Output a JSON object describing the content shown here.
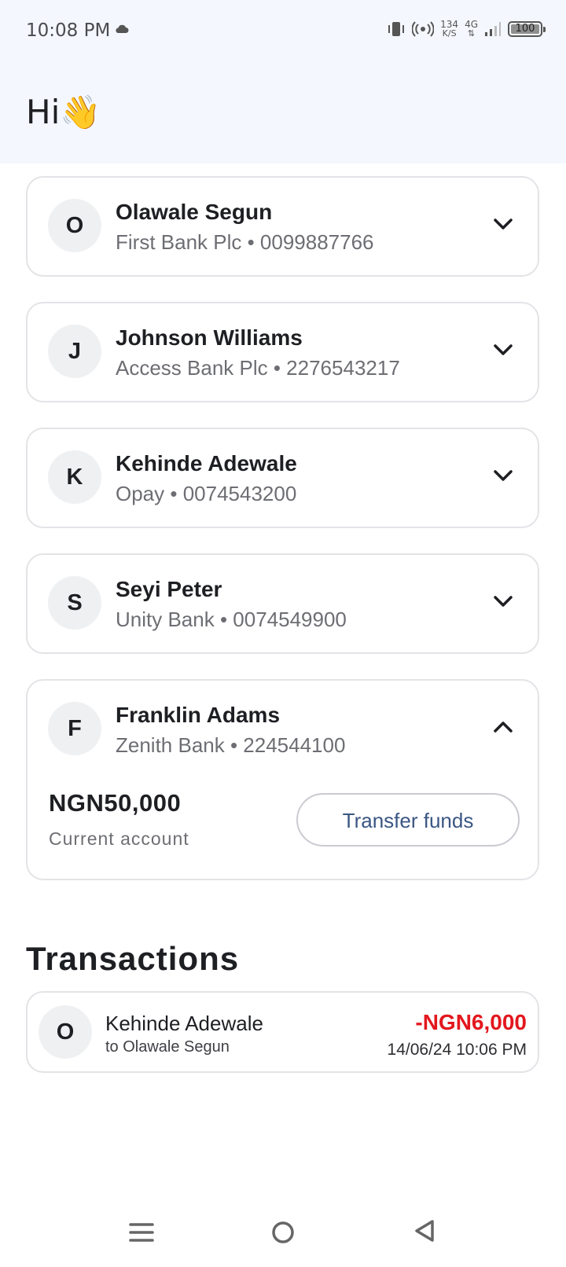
{
  "status_bar": {
    "time": "10:08 PM",
    "net_speed_value": "134",
    "net_speed_unit": "K/S",
    "network": "4G",
    "battery": "100"
  },
  "greeting": {
    "text": "Hi",
    "emoji": "👋"
  },
  "beneficiaries": [
    {
      "initial": "O",
      "name": "Olawale Segun",
      "details": "First Bank Plc • 0099887766",
      "expanded": false
    },
    {
      "initial": "J",
      "name": "Johnson Williams",
      "details": "Access Bank Plc • 2276543217",
      "expanded": false
    },
    {
      "initial": "K",
      "name": "Kehinde Adewale",
      "details": "Opay • 0074543200",
      "expanded": false
    },
    {
      "initial": "S",
      "name": "Seyi Peter",
      "details": "Unity Bank • 0074549900",
      "expanded": false
    },
    {
      "initial": "F",
      "name": "Franklin Adams",
      "details": "Zenith Bank • 224544100",
      "expanded": true,
      "balance": "NGN50,000",
      "account_type": "Current account",
      "action_label": "Transfer funds"
    }
  ],
  "transactions": {
    "title": "Transactions",
    "items": [
      {
        "initial": "O",
        "name": "Kehinde Adewale",
        "description": "to Olawale Segun",
        "amount": "-NGN6,000",
        "datetime": "14/06/24 10:06 PM"
      }
    ]
  },
  "colors": {
    "header_bg": "#f4f7fd",
    "negative_amount": "#e3171d",
    "button_text": "#3b5683"
  },
  "icons": {
    "collapsed": "chevron-down-icon",
    "expanded": "chevron-up-icon",
    "nav": [
      "menu-icon",
      "home-circle-icon",
      "back-triangle-icon"
    ]
  }
}
